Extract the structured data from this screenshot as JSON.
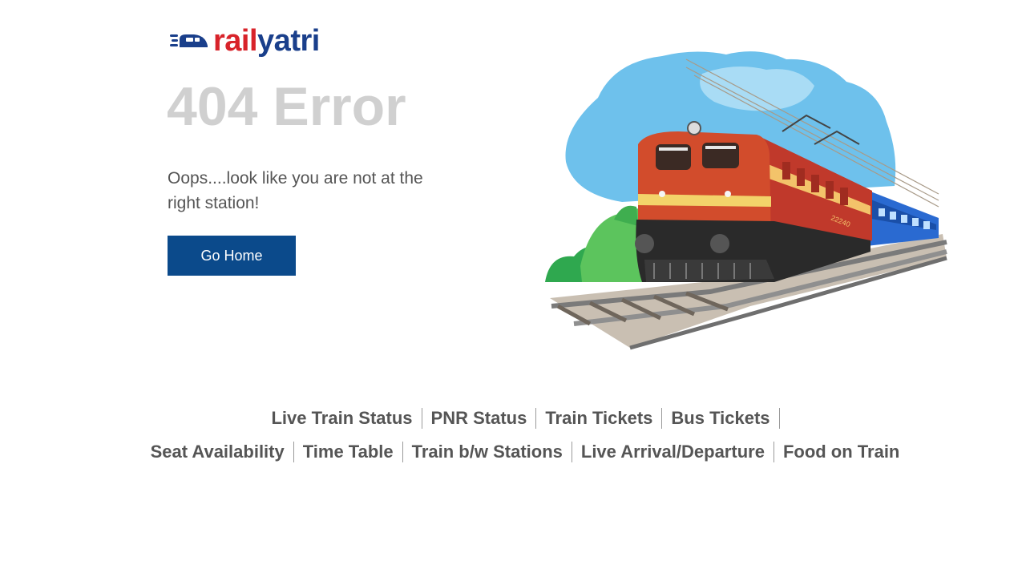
{
  "brand": {
    "name_part1": "rail",
    "name_part2": "yatri",
    "color_red": "#d8232a",
    "color_blue": "#1a3f8b"
  },
  "error": {
    "title": "404 Error",
    "message": "Oops....look like you are not at the right station!",
    "button_label": "Go Home"
  },
  "hero": {
    "icon": "train-illustration-icon",
    "locomotive_number": "22240"
  },
  "footer": {
    "row1": [
      {
        "label": "Live Train Status"
      },
      {
        "label": "PNR Status"
      },
      {
        "label": "Train Tickets"
      },
      {
        "label": "Bus Tickets"
      }
    ],
    "row2": [
      {
        "label": "Seat Availability"
      },
      {
        "label": "Time Table"
      },
      {
        "label": "Train b/w Stations"
      },
      {
        "label": "Live Arrival/Departure"
      },
      {
        "label": "Food on Train"
      }
    ]
  },
  "colors": {
    "button_bg": "#0b4a8b",
    "title_gray": "#d0d0d0",
    "text_gray": "#555555"
  }
}
